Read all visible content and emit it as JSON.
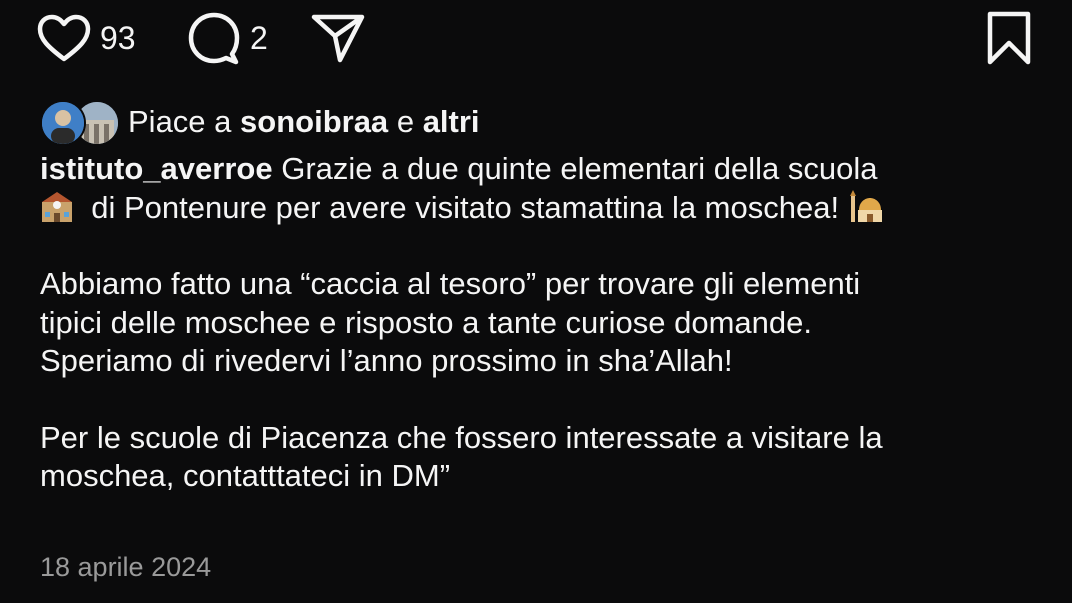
{
  "actions": {
    "like_count": "93",
    "comment_count": "2",
    "icons": [
      "heart-icon",
      "comment-icon",
      "share-icon",
      "bookmark-icon"
    ]
  },
  "likes": {
    "prefix": "Piace a",
    "user": "sonoibraa",
    "conj": "e",
    "others": "altri"
  },
  "post": {
    "username": "istituto_averroe",
    "line1": "Grazie a due quinte elementari della scuola",
    "line2": "di Pontenure per avere visitato stamattina la moschea!",
    "para2_line1": "Abbiamo fatto una “caccia al tesoro” per trovare gli elementi",
    "para2_line2": "tipici delle moschee e risposto a tante curiose domande.",
    "para2_line3": "Speriamo di rivedervi l’anno prossimo in sha’Allah!",
    "para3_line1": "Per le scuole di Piacenza che fossero interessate a visitare la",
    "para3_line2": "moschea, contatttateci in DM”",
    "date": "18 aprile 2024"
  },
  "colors": {
    "background": "#0b0b0c",
    "text": "#f5f5f5",
    "muted": "#9a9a9a"
  }
}
